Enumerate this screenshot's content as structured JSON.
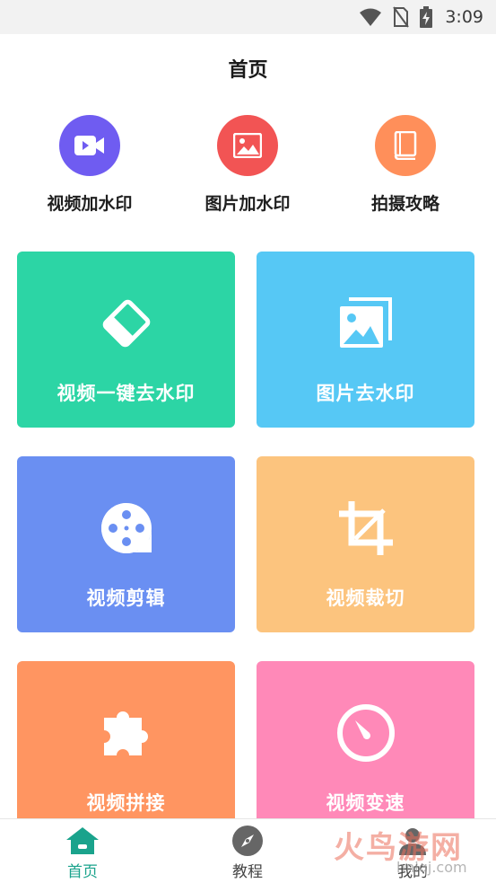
{
  "status_bar": {
    "time": "3:09",
    "icons": [
      "wifi-icon",
      "no-sim-icon",
      "battery-charging-icon"
    ]
  },
  "header": {
    "title": "首页"
  },
  "quick_actions": [
    {
      "label": "视频加水印",
      "icon": "video-camera-icon",
      "color": "#6f5cf1"
    },
    {
      "label": "图片加水印",
      "icon": "image-icon",
      "color": "#f25454"
    },
    {
      "label": "拍摄攻略",
      "icon": "book-icon",
      "color": "#ff8f5a"
    }
  ],
  "cards": [
    {
      "label": "视频一键去水印",
      "icon": "eraser-icon",
      "color": "#2cd5a5"
    },
    {
      "label": "图片去水印",
      "icon": "photos-stack-icon",
      "color": "#56c8f5"
    },
    {
      "label": "视频剪辑",
      "icon": "film-reel-icon",
      "color": "#6a8ff2"
    },
    {
      "label": "视频裁切",
      "icon": "crop-icon",
      "color": "#fcc47e"
    },
    {
      "label": "视频拼接",
      "icon": "puzzle-icon",
      "color": "#ff9561"
    },
    {
      "label": "视频变速",
      "icon": "speedometer-icon",
      "color": "#ff89b8"
    }
  ],
  "bottom_nav": [
    {
      "label": "首页",
      "icon": "home-icon",
      "active": true
    },
    {
      "label": "教程",
      "icon": "compass-icon",
      "active": false
    },
    {
      "label": "我的",
      "icon": "user-icon",
      "active": false
    }
  ],
  "watermark": {
    "text": "火鸟游网",
    "url": "hniqj.com"
  },
  "colors": {
    "accent": "#1aa38c"
  }
}
